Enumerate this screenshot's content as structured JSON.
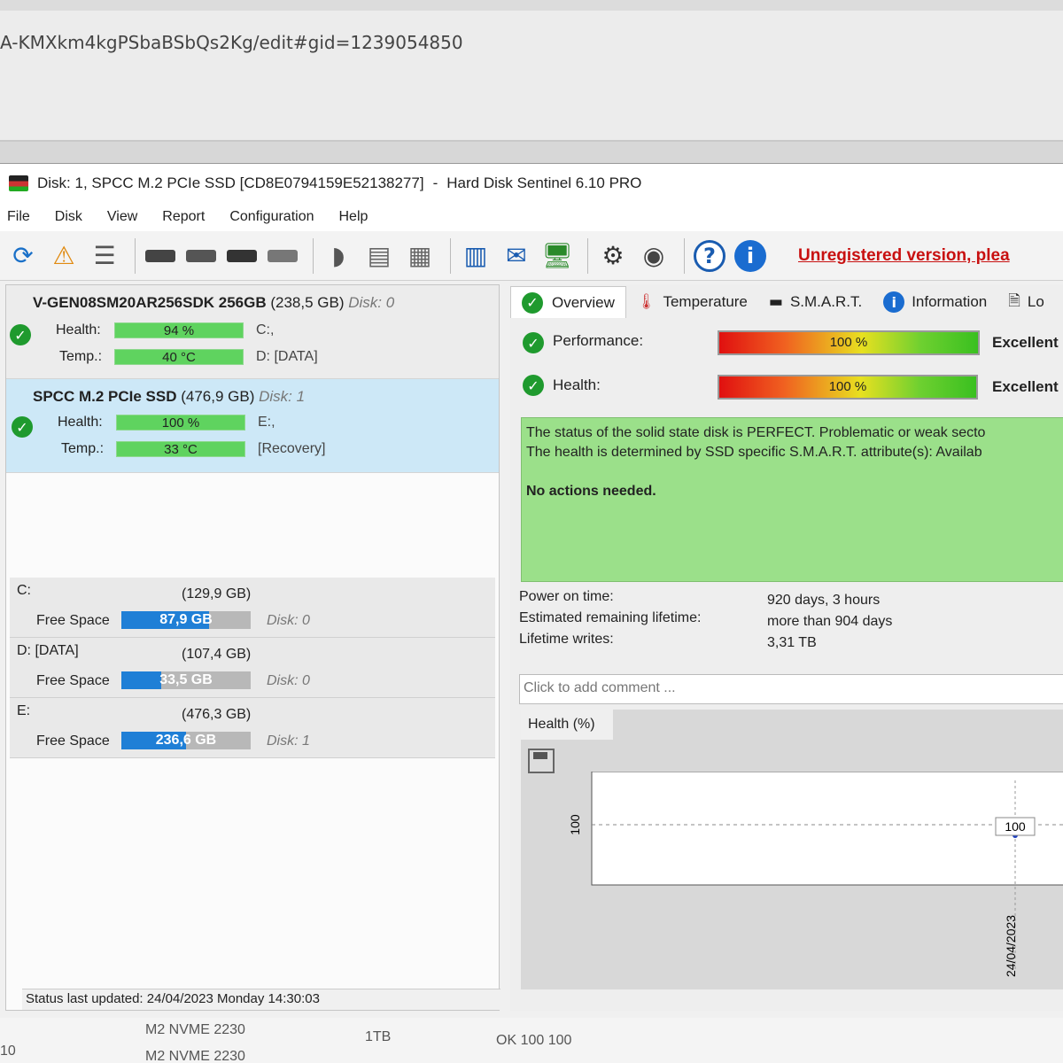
{
  "browser": {
    "url_fragment": "A-KMXkm4kgPSbaBSbQs2Kg/edit#gid=1239054850"
  },
  "background_sheet": {
    "cells": [
      "M2 NVME 2230",
      "M2 NVME 2230",
      "1TB",
      "OK 100 100",
      "10"
    ]
  },
  "window": {
    "title_disk": "Disk: 1, SPCC M.2 PCIe SSD [CD8E0794159E52138277]",
    "title_sep": "-",
    "title_app": "Hard Disk Sentinel 6.10 PRO"
  },
  "menu": [
    "File",
    "Disk",
    "View",
    "Report",
    "Configuration",
    "Help"
  ],
  "toolbar": {
    "unregistered": "Unregistered version, plea"
  },
  "disks": [
    {
      "model": "V-GEN08SM20AR256SDK 256GB",
      "size": "(238,5 GB)",
      "disk_label": "Disk: 0",
      "health_label": "Health:",
      "health": "94 %",
      "health_value": 94,
      "temp_label": "Temp.:",
      "temp": "40 °C",
      "part1": "C:,",
      "part2": "D: [DATA]"
    },
    {
      "model": "SPCC M.2 PCIe SSD",
      "size": "(476,9 GB)",
      "disk_label": "Disk: 1",
      "health_label": "Health:",
      "health": "100 %",
      "health_value": 100,
      "temp_label": "Temp.:",
      "temp": "33 °C",
      "part1": "E:,",
      "part2": "[Recovery]"
    }
  ],
  "volumes": [
    {
      "name": "C:",
      "size": "(129,9 GB)",
      "free_label": "Free Space",
      "free": "87,9 GB",
      "free_fraction": 0.68,
      "disk": "Disk: 0"
    },
    {
      "name": "D: [DATA]",
      "size": "(107,4 GB)",
      "free_label": "Free Space",
      "free": "33,5 GB",
      "free_fraction": 0.31,
      "disk": "Disk: 0"
    },
    {
      "name": "E:",
      "size": "(476,3 GB)",
      "free_label": "Free Space",
      "free": "236,6 GB",
      "free_fraction": 0.5,
      "disk": "Disk: 1"
    }
  ],
  "status_bar": "Status last updated: 24/04/2023 Monday 14:30:03",
  "tabs": [
    "Overview",
    "Temperature",
    "S.M.A.R.T.",
    "Information",
    "Lo"
  ],
  "overview": {
    "performance_label": "Performance:",
    "performance": "100 %",
    "performance_rating": "Excellent",
    "health_label": "Health:",
    "health": "100 %",
    "health_rating": "Excellent",
    "status_line1": "The status of the solid state disk is PERFECT. Problematic or weak secto",
    "status_line2": "The health is determined by SSD specific S.M.A.R.T. attribute(s):  Availab",
    "actions": "No actions needed.",
    "power_on_label": "Power on time:",
    "power_on": "920 days, 3 hours",
    "lifetime_label": "Estimated remaining lifetime:",
    "lifetime": "more than 904 days",
    "writes_label": "Lifetime writes:",
    "writes": "3,31 TB",
    "comment_placeholder": "Click to add comment ..."
  },
  "chart_data": {
    "type": "line",
    "title": "Health (%)",
    "x": [
      "24/04/2023"
    ],
    "values": [
      100
    ],
    "ytick": "100",
    "point_label": "100"
  }
}
